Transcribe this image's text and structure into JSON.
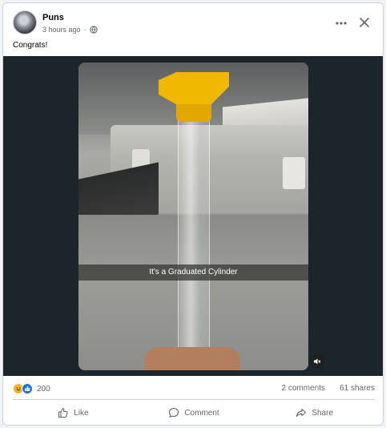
{
  "post": {
    "author": "Puns",
    "time": "3 hours ago",
    "privacy_icon": "globe-icon",
    "caption": "Congrats!"
  },
  "media": {
    "overlay_text": "It's a Graduated Cylinder",
    "mute_icon": "muted-speaker-icon"
  },
  "stats": {
    "reaction_count": "200",
    "reaction_icons": [
      "haha-icon",
      "like-icon"
    ],
    "comments": "2 comments",
    "shares": "61 shares"
  },
  "actions": {
    "like": "Like",
    "comment": "Comment",
    "share": "Share"
  },
  "colors": {
    "accent": "#1b74e4",
    "haha": "#f7b125",
    "video_background": "#1c2529"
  }
}
